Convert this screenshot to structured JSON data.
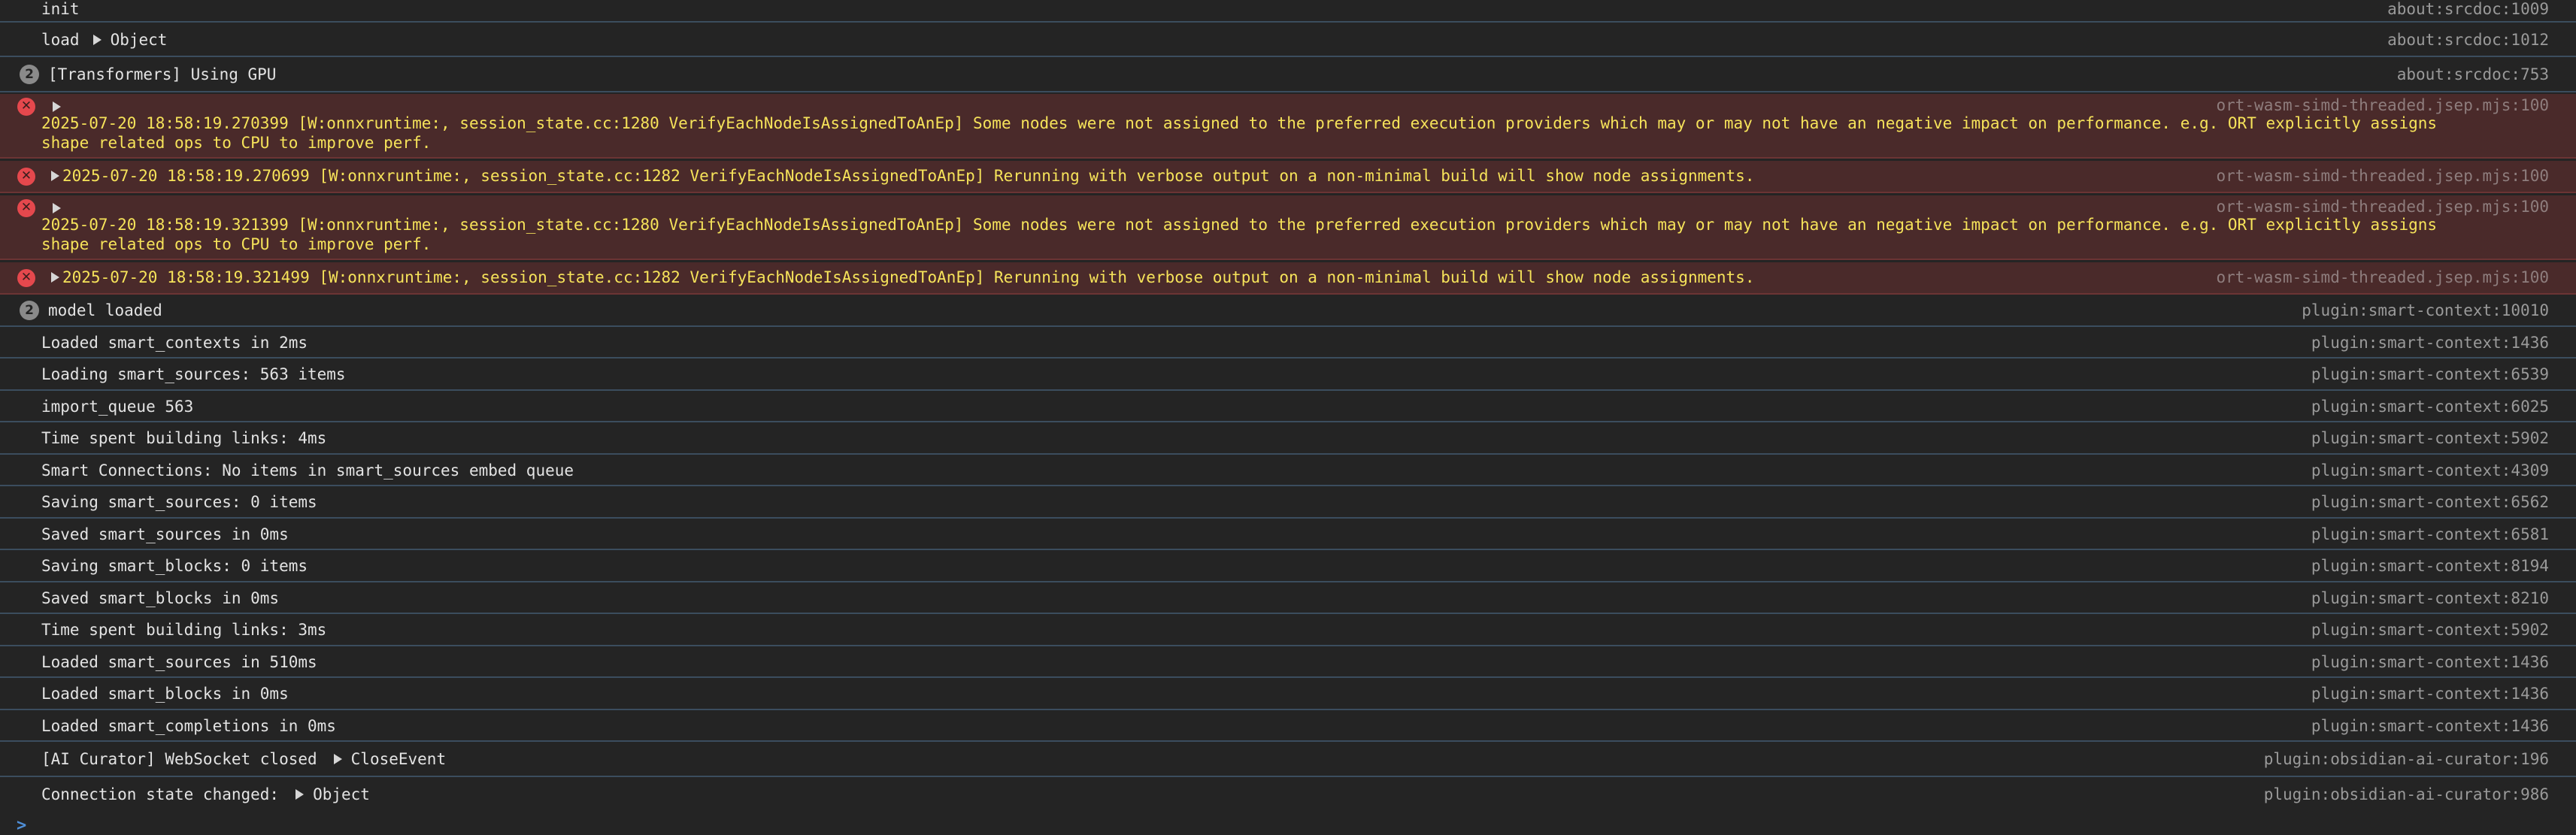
{
  "rows": {
    "init": {
      "text": "init",
      "src": "about:srcdoc:1009"
    },
    "load": {
      "text": "load",
      "obj": "Object",
      "src": "about:srcdoc:1012"
    },
    "gpu": {
      "count": "2",
      "text": "[Transformers] Using GPU",
      "src": "about:srcdoc:753"
    },
    "err1": {
      "line1": "2025-07-20 18:58:19.270399 [W:onnxruntime:, session_state.cc:1280 VerifyEachNodeIsAssignedToAnEp] Some nodes were not assigned to the preferred execution providers which may or may not have an negative impact on performance. e.g. ORT explicitly assigns",
      "line2": "shape related ops to CPU to improve perf.",
      "src": "ort-wasm-simd-threaded.jsep.mjs:100"
    },
    "err2": {
      "text": "2025-07-20 18:58:19.270699 [W:onnxruntime:, session_state.cc:1282 VerifyEachNodeIsAssignedToAnEp] Rerunning with verbose output on a non-minimal build will show node assignments.",
      "src": "ort-wasm-simd-threaded.jsep.mjs:100"
    },
    "err3": {
      "line1": "2025-07-20 18:58:19.321399 [W:onnxruntime:, session_state.cc:1280 VerifyEachNodeIsAssignedToAnEp] Some nodes were not assigned to the preferred execution providers which may or may not have an negative impact on performance. e.g. ORT explicitly assigns",
      "line2": "shape related ops to CPU to improve perf.",
      "src": "ort-wasm-simd-threaded.jsep.mjs:100"
    },
    "err4": {
      "text": "2025-07-20 18:58:19.321499 [W:onnxruntime:, session_state.cc:1282 VerifyEachNodeIsAssignedToAnEp] Rerunning with verbose output on a non-minimal build will show node assignments.",
      "src": "ort-wasm-simd-threaded.jsep.mjs:100"
    },
    "model": {
      "count": "2",
      "text": "model loaded",
      "src": "plugin:smart-context:10010"
    },
    "r1": {
      "text": "Loaded smart_contexts in 2ms",
      "src": "plugin:smart-context:1436"
    },
    "r2": {
      "text": "Loading smart_sources: 563 items",
      "src": "plugin:smart-context:6539"
    },
    "r3": {
      "text": "import_queue 563",
      "src": "plugin:smart-context:6025"
    },
    "r4": {
      "text": "Time spent building links: 4ms",
      "src": "plugin:smart-context:5902"
    },
    "r5": {
      "text": "Smart Connections: No items in smart_sources embed queue",
      "src": "plugin:smart-context:4309"
    },
    "r6": {
      "text": "Saving smart_sources: 0 items",
      "src": "plugin:smart-context:6562"
    },
    "r7": {
      "text": "Saved smart_sources in 0ms",
      "src": "plugin:smart-context:6581"
    },
    "r8": {
      "text": "Saving smart_blocks: 0 items",
      "src": "plugin:smart-context:8194"
    },
    "r9": {
      "text": "Saved smart_blocks in 0ms",
      "src": "plugin:smart-context:8210"
    },
    "r10": {
      "text": "Time spent building links: 3ms",
      "src": "plugin:smart-context:5902"
    },
    "r11": {
      "text": "Loaded smart_sources in 510ms",
      "src": "plugin:smart-context:1436"
    },
    "r12": {
      "text": "Loaded smart_blocks in 0ms",
      "src": "plugin:smart-context:1436"
    },
    "r13": {
      "text": "Loaded smart_completions in 0ms",
      "src": "plugin:smart-context:1436"
    },
    "ws": {
      "text": "[AI Curator] WebSocket closed",
      "obj": "CloseEvent",
      "src": "plugin:obsidian-ai-curator:196"
    },
    "conn": {
      "text": "Connection state changed:",
      "obj": "Object",
      "src": "plugin:obsidian-ai-curator:986"
    }
  },
  "prompt": ">",
  "colors": {
    "background": "#242424",
    "error_bg": "#4a2a2a",
    "warning_text": "#f6e35a",
    "error_icon": "#e5484d",
    "prompt": "#4f8fd8"
  }
}
